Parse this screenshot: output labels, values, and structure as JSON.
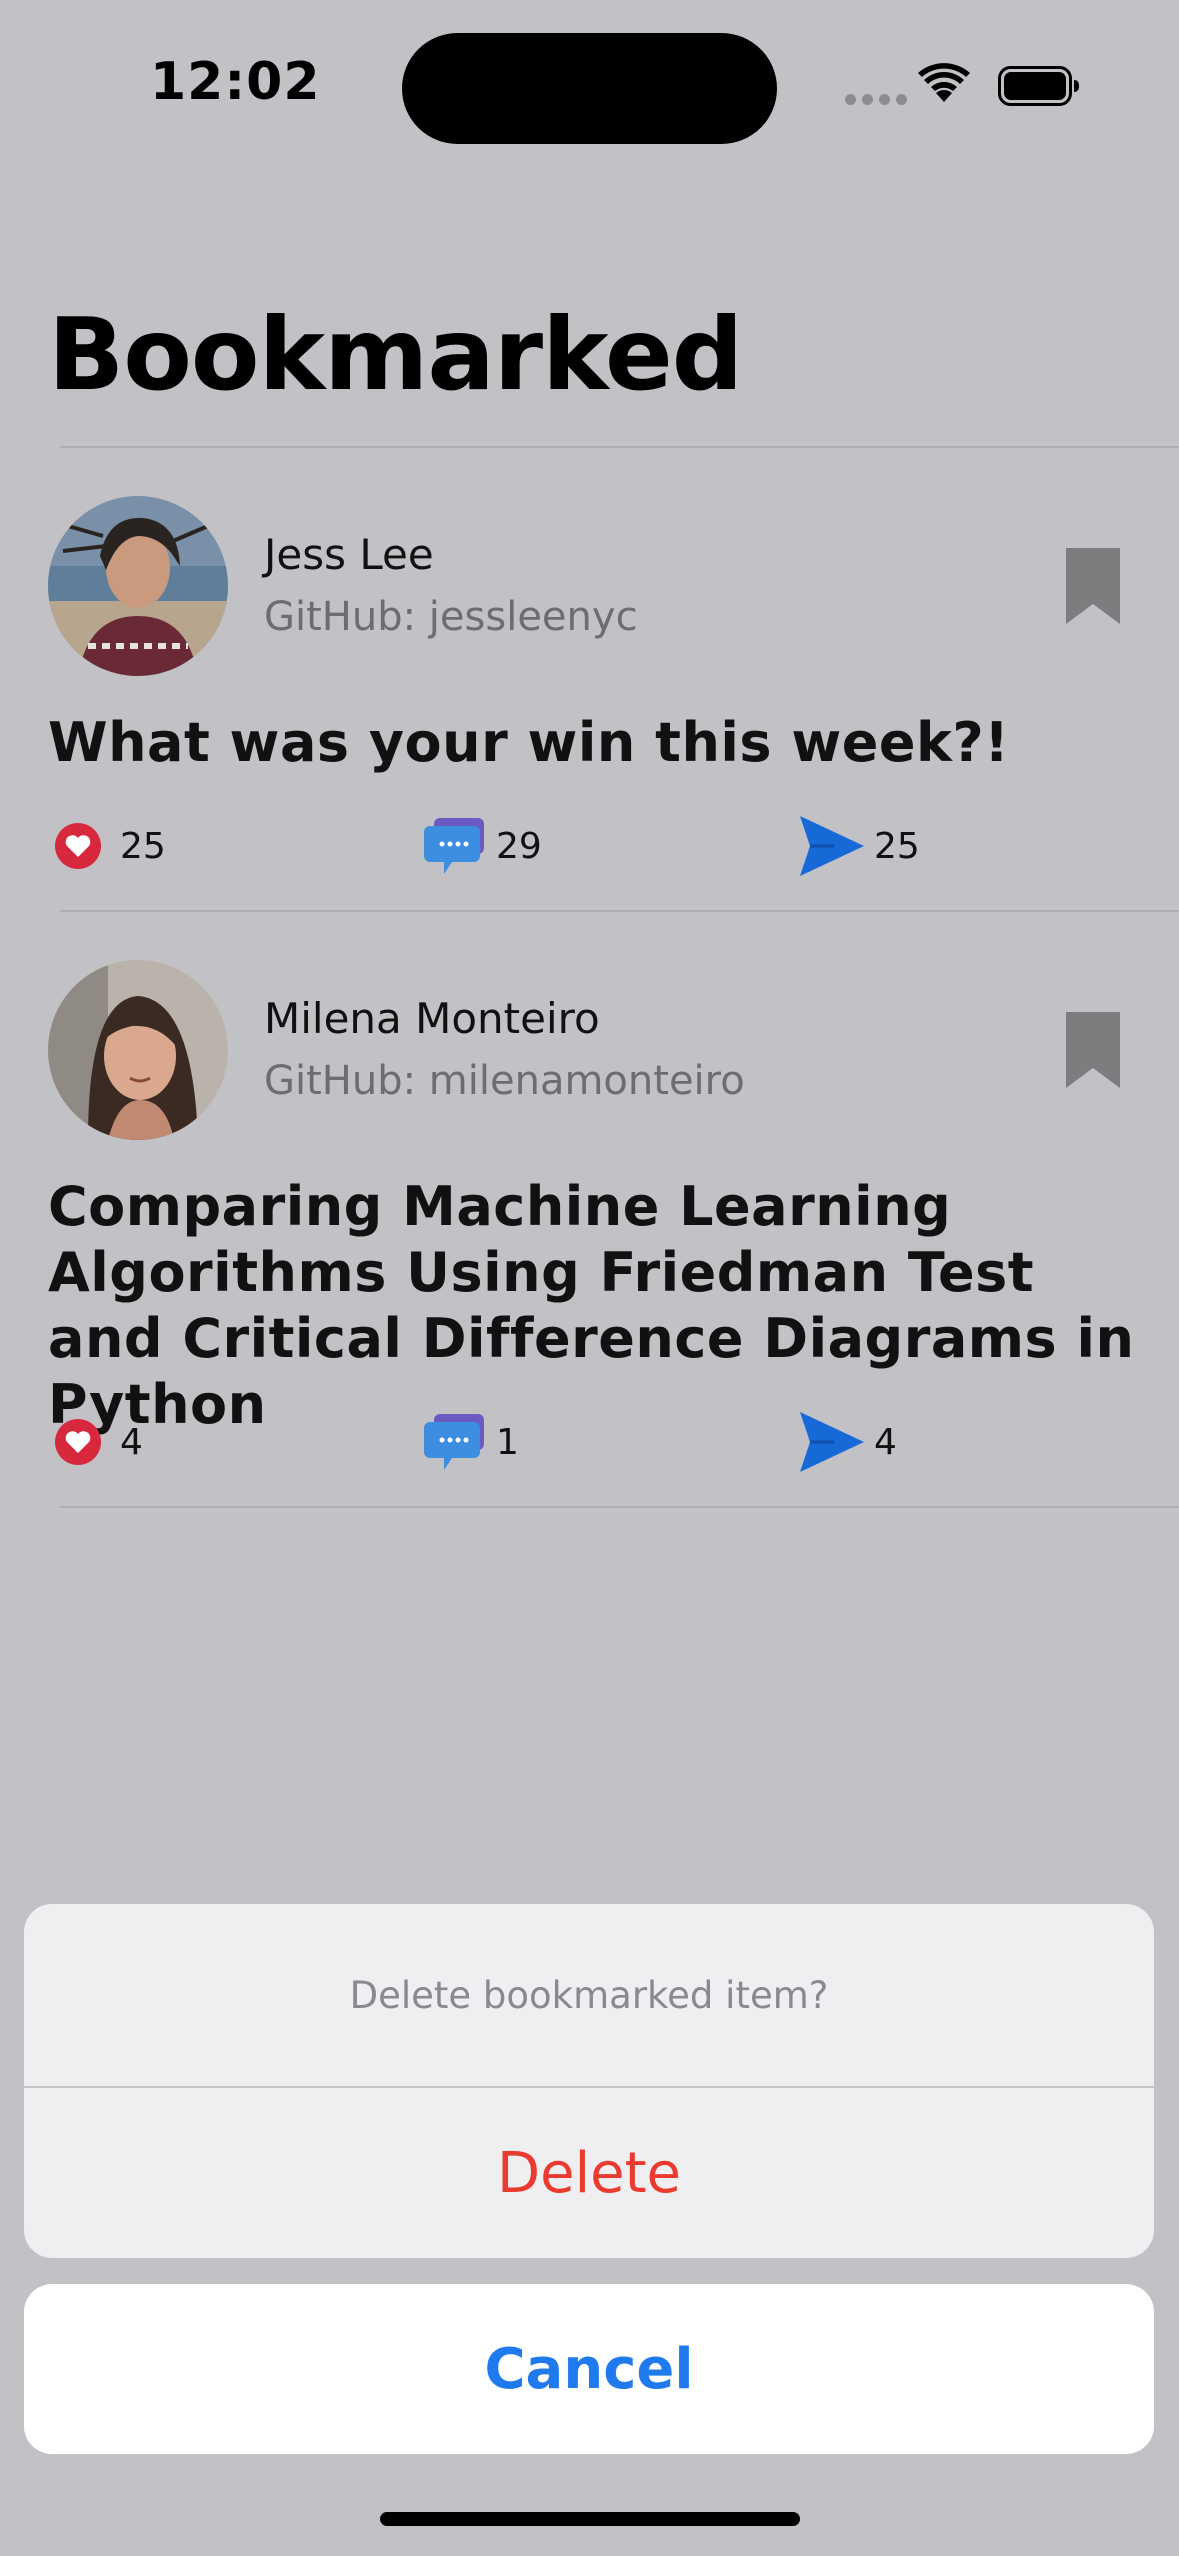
{
  "status_bar": {
    "time": "12:02"
  },
  "page": {
    "title": "Bookmarked"
  },
  "posts": [
    {
      "author": "Jess Lee",
      "github": "GitHub: jessleenyc",
      "title": "What was your win this week?!",
      "likes": "25",
      "comments": "29",
      "shares": "25"
    },
    {
      "author": "Milena Monteiro",
      "github": "GitHub: milenamonteiro",
      "title": "Comparing Machine Learning Algorithms Using Friedman Test and Critical Difference Diagrams in Python",
      "likes": "4",
      "comments": "1",
      "shares": "4"
    }
  ],
  "action_sheet": {
    "message": "Delete bookmarked item?",
    "delete_label": "Delete",
    "cancel_label": "Cancel"
  },
  "colors": {
    "background": "#c2c1c6",
    "destructive": "#eb3b30",
    "accent": "#1f7aee",
    "like": "#d8283e",
    "share": "#1669d6"
  },
  "icons": [
    "wifi-icon",
    "battery-icon",
    "bookmark-icon",
    "heart-icon",
    "comment-icon",
    "send-icon"
  ]
}
